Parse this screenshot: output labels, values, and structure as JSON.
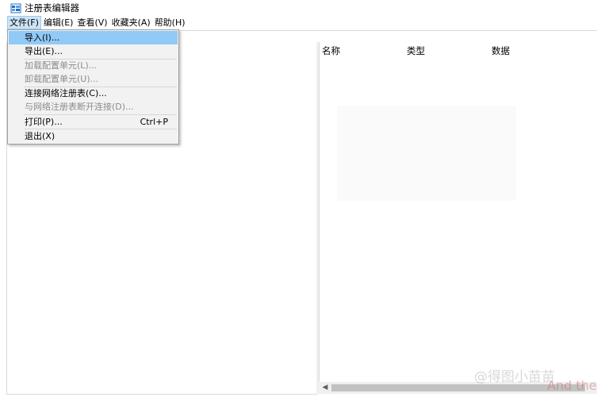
{
  "window": {
    "title": "注册表编辑器",
    "icon": "registry-editor-icon"
  },
  "menubar": {
    "items": [
      "文件(F)",
      "编辑(E)",
      "查看(V)",
      "收藏夹(A)",
      "帮助(H)"
    ]
  },
  "file_menu": {
    "items": [
      {
        "label": "导入(I)...",
        "enabled": true,
        "highlighted": true
      },
      {
        "label": "导出(E)...",
        "enabled": true
      },
      {
        "label": "加载配置单元(L)...",
        "enabled": false
      },
      {
        "label": "卸载配置单元(U)...",
        "enabled": false
      },
      {
        "label": "连接网络注册表(C)...",
        "enabled": true
      },
      {
        "label": "与网络注册表断开连接(D)...",
        "enabled": false
      },
      {
        "label": "打印(P)...",
        "enabled": true,
        "shortcut": "Ctrl+P"
      },
      {
        "label": "退出(X)",
        "enabled": true
      }
    ]
  },
  "list": {
    "columns": [
      "名称",
      "类型",
      "数据"
    ]
  },
  "watermark": {
    "text": "@得图小苗苗",
    "text2": "And the"
  },
  "colors": {
    "menu_highlight": "#91c9f7",
    "menu_background": "#f2f2f2",
    "disabled_text": "#8c8c8c"
  }
}
